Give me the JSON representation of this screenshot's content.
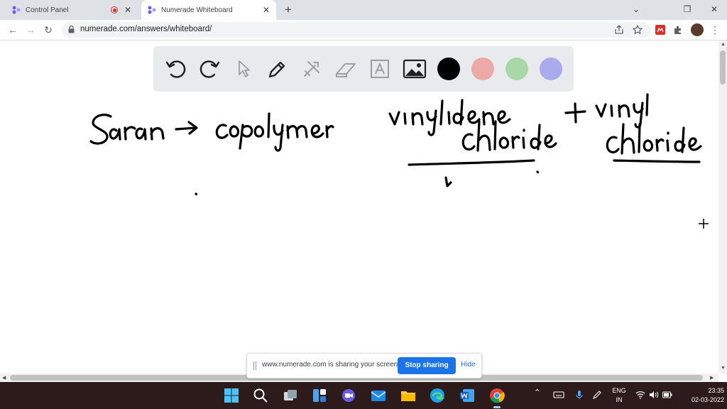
{
  "tabs": [
    {
      "title": "Control Panel",
      "state": "inactive",
      "recording": true
    },
    {
      "title": "Numerade Whiteboard",
      "state": "active"
    }
  ],
  "url": "numerade.com/answers/whiteboard/",
  "whiteboard": {
    "tools": [
      "undo-icon",
      "redo-icon",
      "pointer-icon",
      "pen-icon",
      "tools-icon",
      "eraser-icon",
      "text-icon",
      "image-icon"
    ],
    "colors": [
      "#000000",
      "#eda8a8",
      "#a8d8a8",
      "#aaaaee"
    ],
    "handwriting": [
      "Saran",
      "→",
      "copolymer",
      "vinylidene",
      "chloride",
      "+",
      "vinyl",
      "chloride"
    ]
  },
  "share_banner": {
    "message": "www.numerade.com is sharing your screen.",
    "stop": "Stop sharing",
    "hide": "Hide"
  },
  "taskbar": {
    "lang_top": "ENG",
    "lang_bottom": "IN",
    "time": "23:35",
    "date": "02-03-2022"
  }
}
